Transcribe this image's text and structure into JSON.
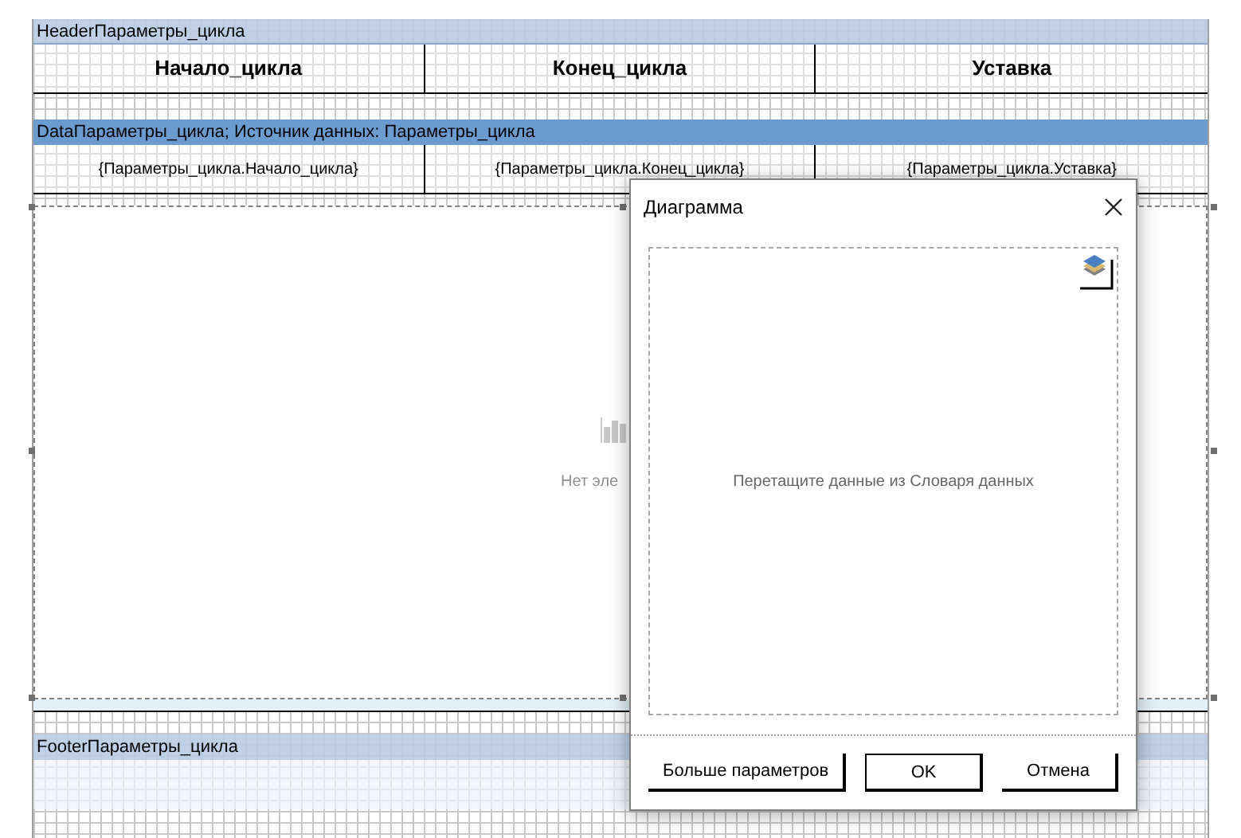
{
  "header_band": {
    "title": "HeaderПараметры_цикла",
    "cells": [
      "Начало_цикла",
      "Конец_цикла",
      "Уставка"
    ]
  },
  "data_band": {
    "title": "DataПараметры_цикла; Источник данных: Параметры_цикла",
    "cells": [
      "{Параметры_цикла.Начало_цикла}",
      "{Параметры_цикла.Конец_цикла}",
      "{Параметры_цикла.Уставка}"
    ]
  },
  "chart_component": {
    "empty_text": "Нет эле"
  },
  "footer_band": {
    "title": "FooterПараметры_цикла"
  },
  "dialog": {
    "title": "Диаграмма",
    "drop_hint": "Перетащите данные из Словаря данных",
    "buttons": [
      {
        "label": "Больше параметров",
        "kind": "secondary"
      },
      {
        "label": "OK",
        "kind": "default"
      },
      {
        "label": "Отмена",
        "kind": "secondary"
      }
    ]
  }
}
